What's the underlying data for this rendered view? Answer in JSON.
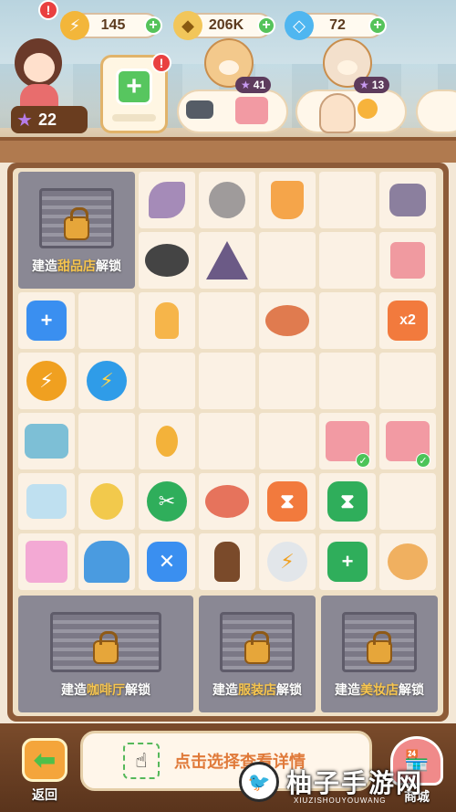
{
  "resources": {
    "energy": {
      "icon": "lightning-icon",
      "value": "145"
    },
    "coins": {
      "icon": "coin-icon",
      "value": "206K"
    },
    "gems": {
      "icon": "diamond-icon",
      "value": "72"
    }
  },
  "player": {
    "level": "22"
  },
  "notifications": {
    "avatar": "!",
    "inbox": "!"
  },
  "customers": [
    {
      "level": "41"
    },
    {
      "level": "13"
    }
  ],
  "board": {
    "locked_top": {
      "prefix": "建造",
      "shop": "甜品店",
      "suffix": "解锁"
    },
    "locked_bottom": [
      {
        "prefix": "建造",
        "shop": "咖啡厅",
        "suffix": "解锁"
      },
      {
        "prefix": "建造",
        "shop": "服装店",
        "suffix": "解锁"
      },
      {
        "prefix": "建造",
        "shop": "美妆店",
        "suffix": "解锁"
      }
    ],
    "badges": {
      "x2": "x2"
    }
  },
  "bottom": {
    "back_label": "返回",
    "hint_text": "点击选择查看详情",
    "shop_label": "商城"
  },
  "watermark": {
    "text": "柚子手游网",
    "sub": "XIUZISHOUYOUWANG"
  }
}
